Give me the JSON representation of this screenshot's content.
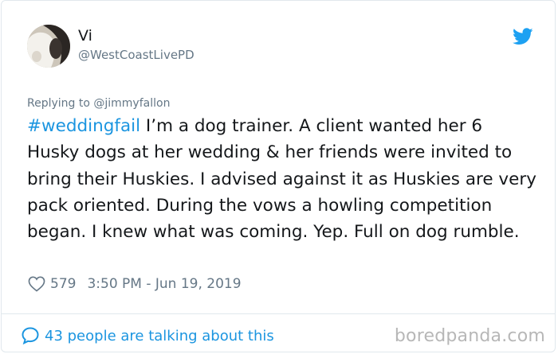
{
  "user": {
    "display_name": "Vi",
    "handle": "@WestCoastLivePD",
    "avatar_icon": "avatar-photo"
  },
  "brand": {
    "icon": "twitter-bird-icon",
    "color": "#1da1f2"
  },
  "tweet": {
    "replying_to": "Replying to @jimmyfallon",
    "hashtag": "#weddingfail",
    "body": " I’m a dog trainer. A client wanted her 6 Husky dogs at her wedding & her friends were invited to bring their Huskies. I advised against it as Huskies are very pack oriented. During the vows a howling competition began. I knew what was coming. Yep. Full on dog rumble.",
    "likes": "579",
    "timestamp": "3:50 PM - Jun 19, 2019"
  },
  "footer": {
    "talking": "43 people are talking about this",
    "watermark": "boredpanda.com"
  },
  "colors": {
    "text": "#14171a",
    "secondary": "#657786",
    "link": "#1b95e0",
    "border": "#e1e8ed"
  }
}
